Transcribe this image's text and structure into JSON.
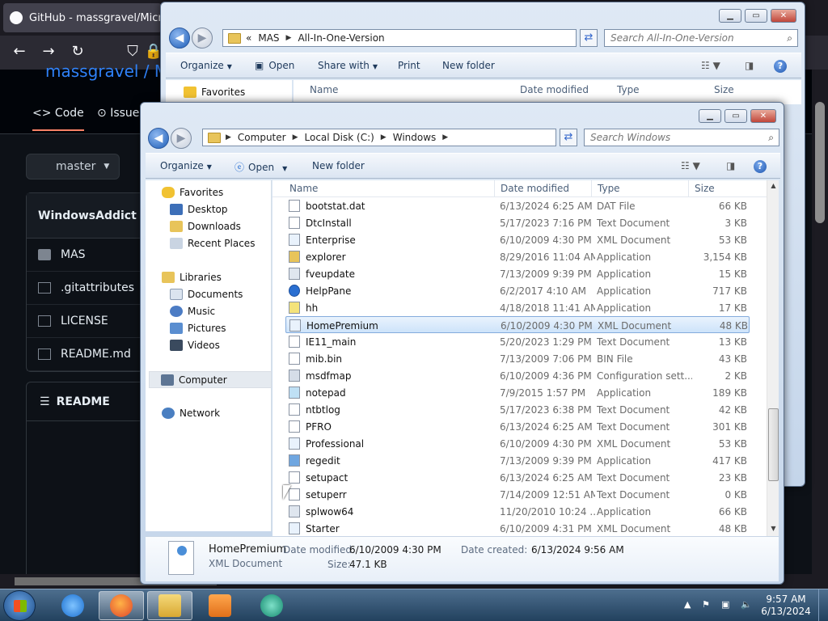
{
  "browser": {
    "tab_title": "GitHub - massgravel/Microsoft",
    "repo_path": "massgravel / Mic",
    "tabs": [
      {
        "label": "Code"
      },
      {
        "label": "Issue"
      }
    ],
    "branch": "master",
    "repo_header": "WindowsAddict",
    "files": [
      {
        "name": "MAS",
        "icon": "folder-icon"
      },
      {
        "name": ".gitattributes",
        "icon": "file-icon"
      },
      {
        "name": "LICENSE",
        "icon": "file-icon"
      },
      {
        "name": "README.md",
        "icon": "file-icon"
      }
    ],
    "readme_tab": "README"
  },
  "back_window": {
    "breadcrumb": [
      "«",
      "MAS",
      "All-In-One-Version"
    ],
    "search_placeholder": "Search All-In-One-Version",
    "commands": {
      "organize": "Organize",
      "open": "Open",
      "share_with": "Share with",
      "print": "Print",
      "new_folder": "New folder"
    },
    "favorites": "Favorites",
    "columns": [
      "Name",
      "Date modified",
      "Type",
      "Size"
    ]
  },
  "front_window": {
    "breadcrumb": [
      "Computer",
      "Local Disk (C:)",
      "Windows"
    ],
    "search_placeholder": "Search Windows",
    "commands": {
      "organize": "Organize",
      "open": "Open",
      "new_folder": "New folder"
    },
    "nav": {
      "favorites": "Favorites",
      "desktop": "Desktop",
      "downloads": "Downloads",
      "recent_places": "Recent Places",
      "libraries": "Libraries",
      "documents": "Documents",
      "music": "Music",
      "pictures": "Pictures",
      "videos": "Videos",
      "computer": "Computer",
      "network": "Network"
    },
    "columns": {
      "name": "Name",
      "date": "Date modified",
      "type": "Type",
      "size": "Size"
    },
    "files": [
      {
        "name": "bootstat.dat",
        "date": "6/13/2024 6:25 AM",
        "type": "DAT File",
        "size": "66 KB",
        "icon": "file-icon"
      },
      {
        "name": "DtcInstall",
        "date": "5/17/2023 7:16 PM",
        "type": "Text Document",
        "size": "3 KB",
        "icon": "text-file-icon"
      },
      {
        "name": "Enterprise",
        "date": "6/10/2009 4:30 PM",
        "type": "XML Document",
        "size": "53 KB",
        "icon": "xml-file-icon"
      },
      {
        "name": "explorer",
        "date": "8/29/2016 11:04 AM",
        "type": "Application",
        "size": "3,154 KB",
        "icon": "folder-app-icon"
      },
      {
        "name": "fveupdate",
        "date": "7/13/2009 9:39 PM",
        "type": "Application",
        "size": "15 KB",
        "icon": "app-icon"
      },
      {
        "name": "HelpPane",
        "date": "6/2/2017 4:10 AM",
        "type": "Application",
        "size": "717 KB",
        "icon": "help-icon"
      },
      {
        "name": "hh",
        "date": "4/18/2018 11:41 AM",
        "type": "Application",
        "size": "17 KB",
        "icon": "help-file-icon"
      },
      {
        "name": "HomePremium",
        "date": "6/10/2009 4:30 PM",
        "type": "XML Document",
        "size": "48 KB",
        "icon": "xml-file-icon"
      },
      {
        "name": "IE11_main",
        "date": "5/20/2023 1:29 PM",
        "type": "Text Document",
        "size": "13 KB",
        "icon": "text-file-icon"
      },
      {
        "name": "mib.bin",
        "date": "7/13/2009 7:06 PM",
        "type": "BIN File",
        "size": "43 KB",
        "icon": "file-icon"
      },
      {
        "name": "msdfmap",
        "date": "6/10/2009 4:36 PM",
        "type": "Configuration sett...",
        "size": "2 KB",
        "icon": "config-file-icon"
      },
      {
        "name": "notepad",
        "date": "7/9/2015 1:57 PM",
        "type": "Application",
        "size": "189 KB",
        "icon": "notepad-icon"
      },
      {
        "name": "ntbtlog",
        "date": "5/17/2023 6:38 PM",
        "type": "Text Document",
        "size": "42 KB",
        "icon": "text-file-icon"
      },
      {
        "name": "PFRO",
        "date": "6/13/2024 6:25 AM",
        "type": "Text Document",
        "size": "301 KB",
        "icon": "text-file-icon"
      },
      {
        "name": "Professional",
        "date": "6/10/2009 4:30 PM",
        "type": "XML Document",
        "size": "53 KB",
        "icon": "xml-file-icon"
      },
      {
        "name": "regedit",
        "date": "7/13/2009 9:39 PM",
        "type": "Application",
        "size": "417 KB",
        "icon": "regedit-icon"
      },
      {
        "name": "setupact",
        "date": "6/13/2024 6:25 AM",
        "type": "Text Document",
        "size": "23 KB",
        "icon": "text-file-icon"
      },
      {
        "name": "setuperr",
        "date": "7/14/2009 12:51 AM",
        "type": "Text Document",
        "size": "0 KB",
        "icon": "text-file-icon"
      },
      {
        "name": "splwow64",
        "date": "11/20/2010 10:24 ...",
        "type": "Application",
        "size": "66 KB",
        "icon": "app-icon"
      },
      {
        "name": "Starter",
        "date": "6/10/2009 4:31 PM",
        "type": "XML Document",
        "size": "48 KB",
        "icon": "xml-file-icon"
      }
    ],
    "selected_file": "HomePremium",
    "details": {
      "name": "HomePremium",
      "type": "XML Document",
      "date_modified_label": "Date modified:",
      "date_modified": "6/10/2009 4:30 PM",
      "size_label": "Size:",
      "size": "47.1 KB",
      "date_created_label": "Date created:",
      "date_created": "6/13/2024 9:56 AM"
    }
  },
  "taskbar": {
    "time": "9:57 AM",
    "date": "6/13/2024"
  },
  "colors": {
    "selection_fill": "#cde3fa",
    "selection_border": "#84acdd",
    "github_link": "#2f81f7",
    "taskbar": "#22415e"
  }
}
